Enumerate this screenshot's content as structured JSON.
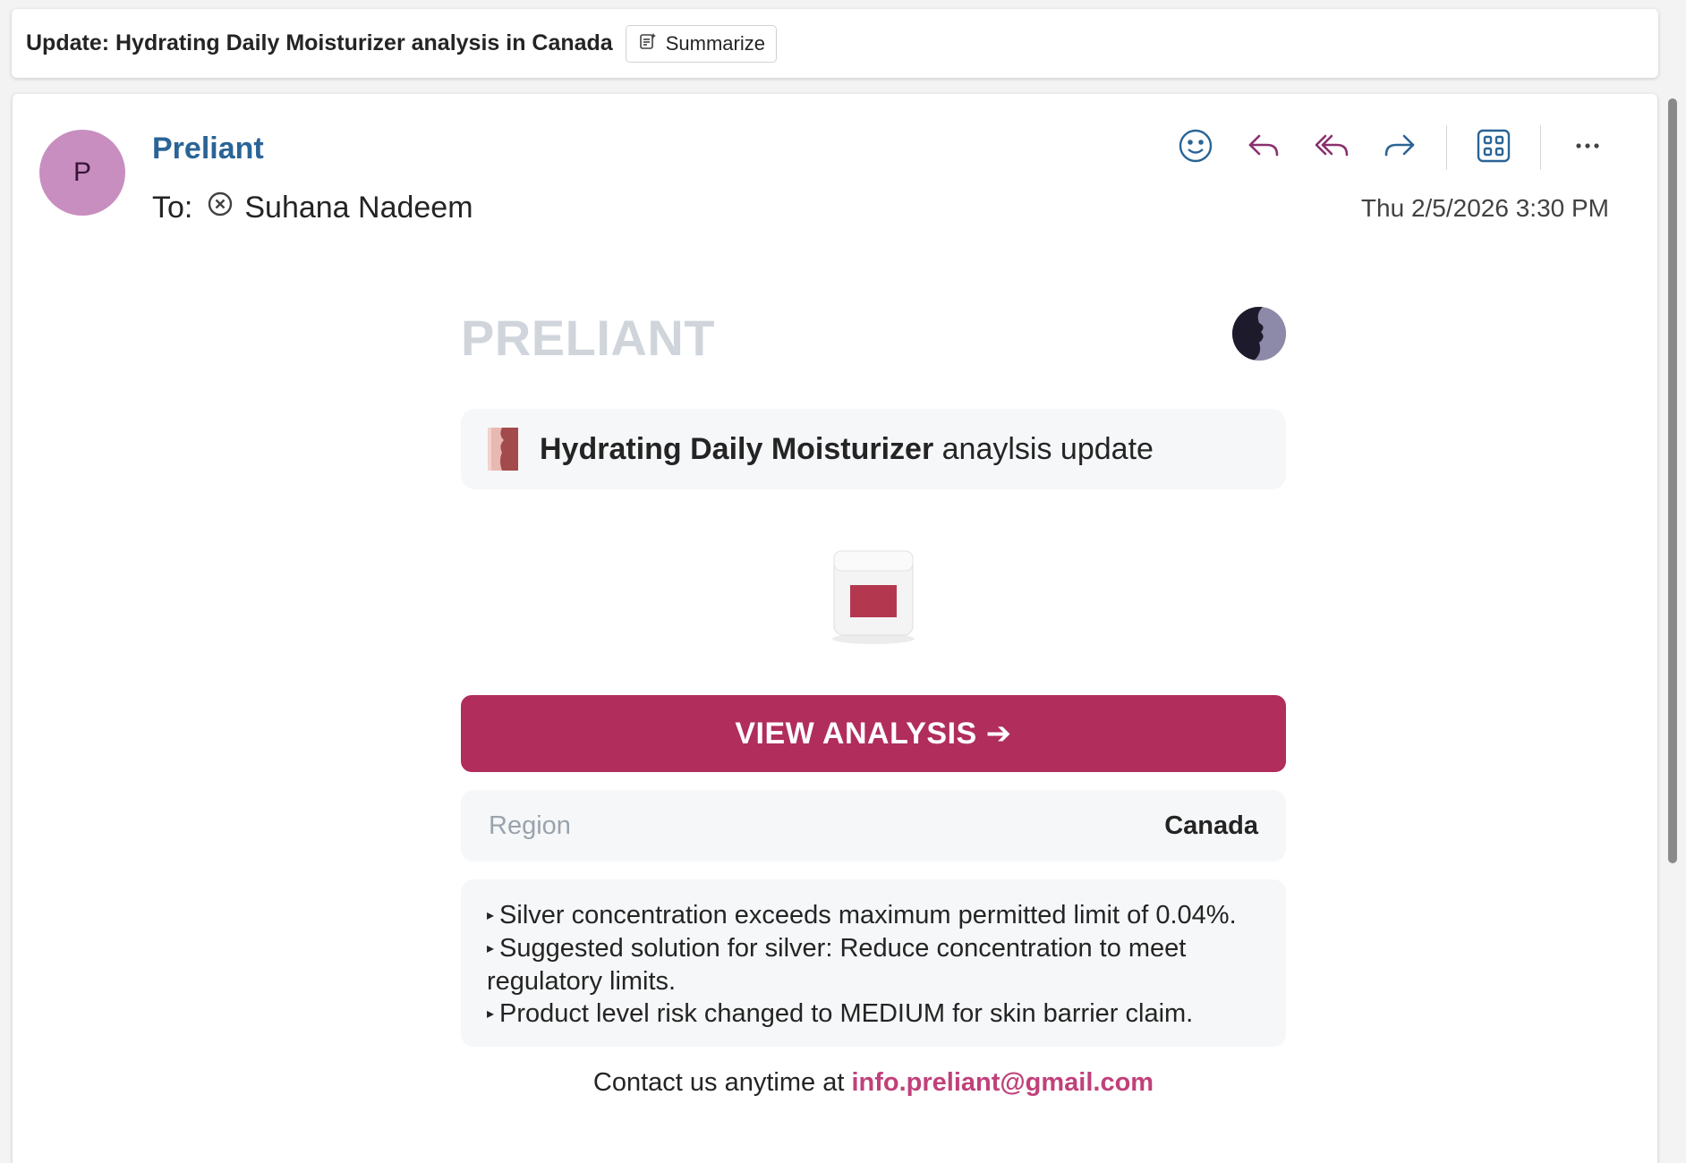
{
  "subject": {
    "title": "Update: Hydrating Daily Moisturizer analysis in Canada",
    "summarize_label": "Summarize"
  },
  "header": {
    "avatar_initial": "P",
    "sender_name": "Preliant",
    "to_label": "To:",
    "recipient": "Suhana Nadeem",
    "timestamp": "Thu 2/5/2026 3:30 PM"
  },
  "toolbar": {
    "icons": [
      "emoji-icon",
      "reply-icon",
      "reply-all-icon",
      "forward-icon",
      "apps-icon",
      "more-icon"
    ]
  },
  "body": {
    "brand": "PRELIANT",
    "title_bold": "Hydrating Daily Moisturizer",
    "title_rest": " anaylsis update",
    "cta_label": "VIEW ANALYSIS ➔",
    "region_label": "Region",
    "region_value": "Canada",
    "notes": [
      "Silver concentration exceeds maximum permitted limit of 0.04%.",
      "Suggested solution for silver: Reduce concentration to meet regulatory limits.",
      "Product level risk changed to MEDIUM for skin barrier claim."
    ],
    "contact_prefix": "Contact us anytime at ",
    "contact_email": "info.preliant@gmail.com"
  },
  "colors": {
    "accent": "#b02d5c",
    "link": "#c0417a",
    "sender": "#2a6496",
    "avatar": "#c88ec0"
  }
}
